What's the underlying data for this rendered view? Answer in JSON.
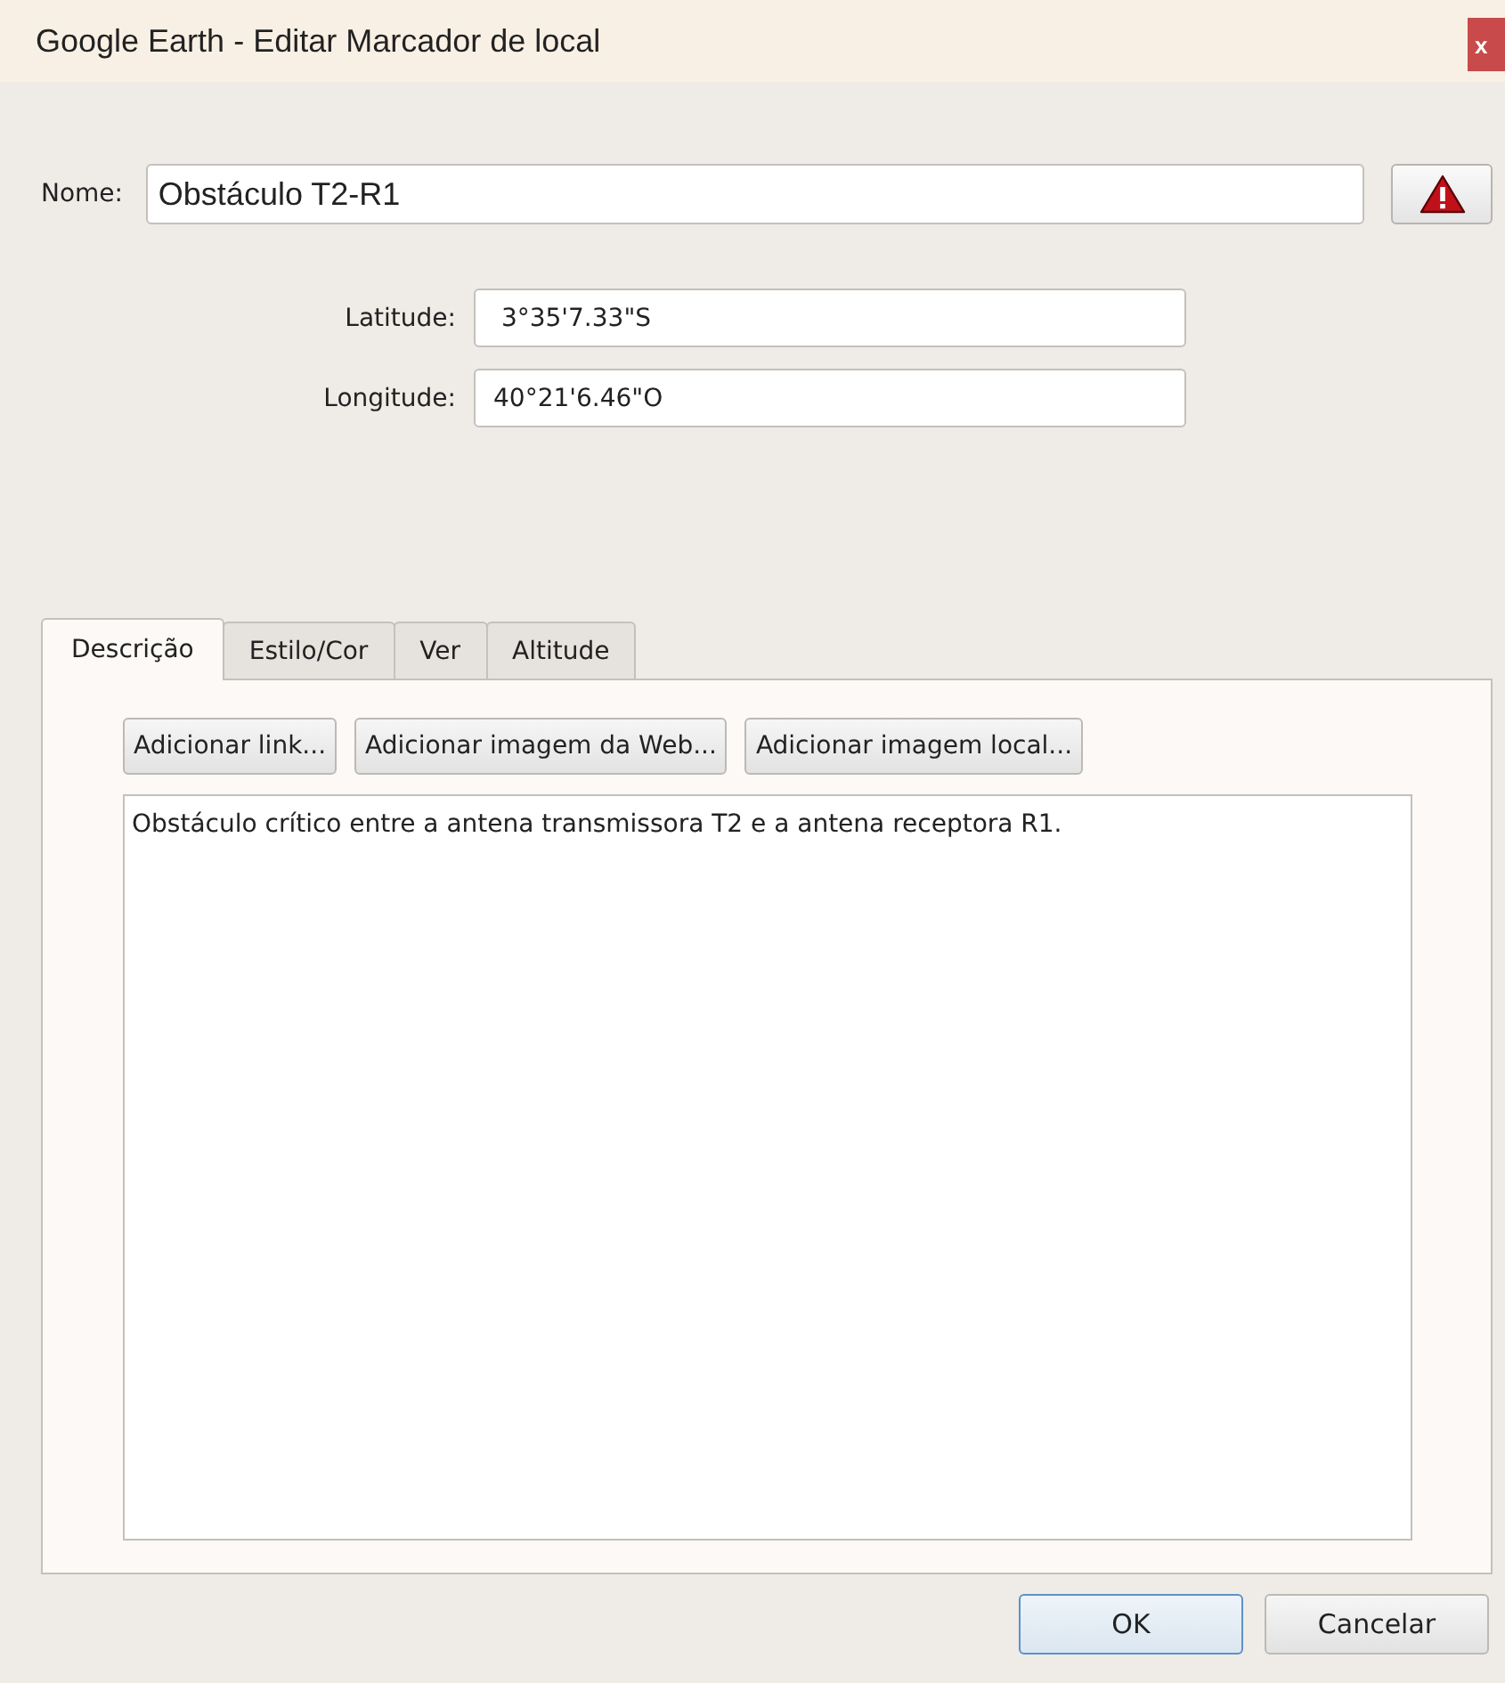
{
  "window": {
    "title": "Google Earth - Editar Marcador de local",
    "close": "x"
  },
  "name": {
    "label": "Nome:",
    "value": "Obstáculo T2-R1"
  },
  "coords": [
    {
      "label": "Latitude:",
      "value": " 3°35'7.33\"S"
    },
    {
      "label": "Longitude:",
      "value": "40°21'6.46\"O"
    }
  ],
  "tabs": [
    {
      "label": "Descrição",
      "selected": true
    },
    {
      "label": "Estilo/Cor",
      "selected": false
    },
    {
      "label": "Ver",
      "selected": false
    },
    {
      "label": "Altitude",
      "selected": false
    }
  ],
  "toolbar": [
    "Adicionar link...",
    "Adicionar imagem da Web...",
    "Adicionar imagem local..."
  ],
  "description": "Obstáculo crítico entre a antena transmissora T2 e a antena receptora R1.",
  "buttons": [
    {
      "label": "OK",
      "kind": "default"
    },
    {
      "label": "Cancelar",
      "kind": "normal"
    }
  ]
}
